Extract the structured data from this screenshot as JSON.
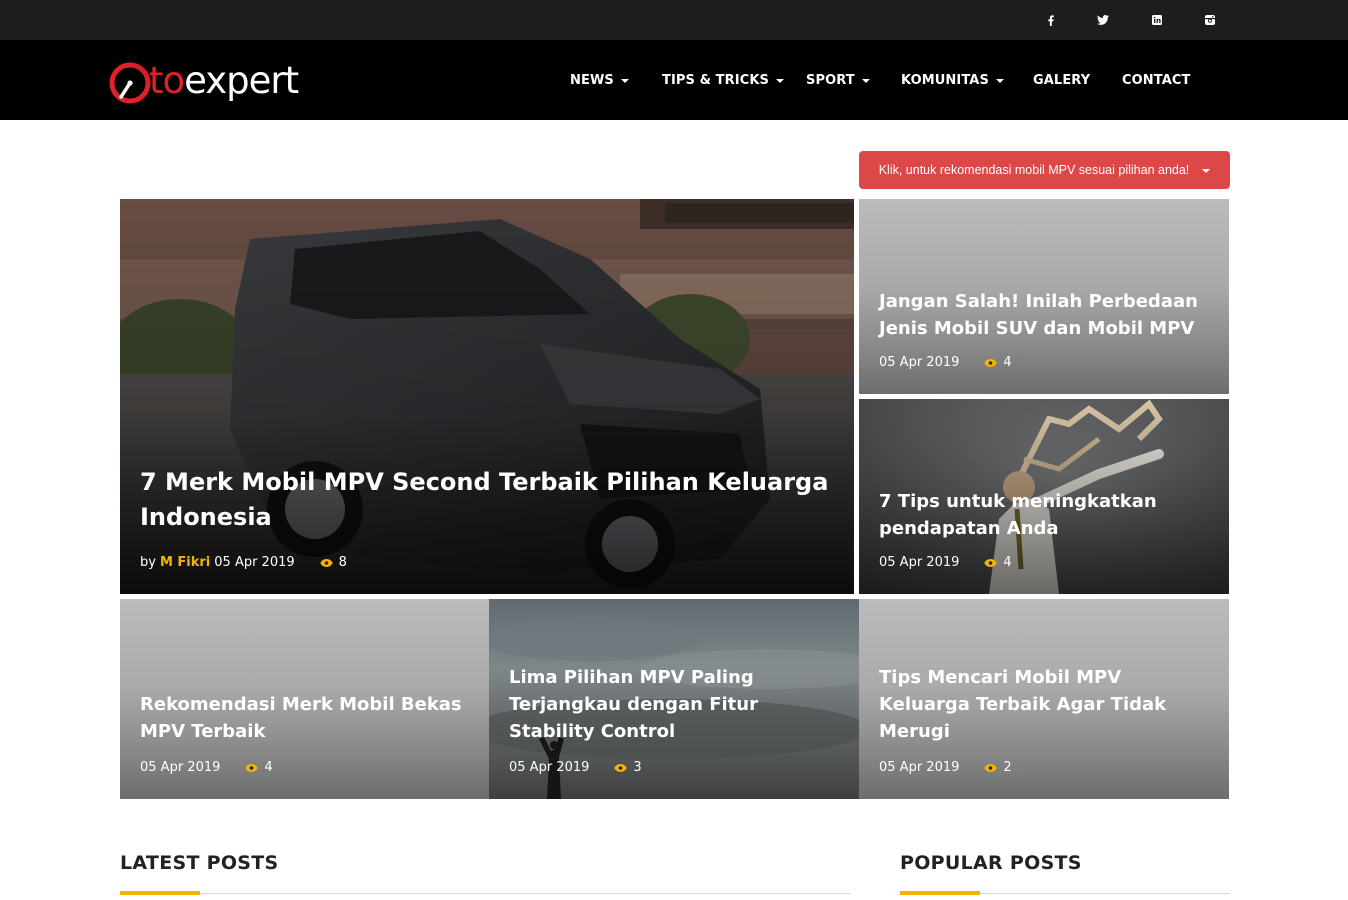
{
  "social": [
    {
      "name": "facebook-icon"
    },
    {
      "name": "twitter-icon"
    },
    {
      "name": "linkedin-icon"
    },
    {
      "name": "instagram-icon"
    }
  ],
  "logo": {
    "text_red": "to",
    "text_white": "expert"
  },
  "nav": [
    {
      "label": "NEWS",
      "dropdown": true
    },
    {
      "label": "TIPS & TRICKS",
      "dropdown": true
    },
    {
      "label": "SPORT",
      "dropdown": true
    },
    {
      "label": "KOMUNITAS",
      "dropdown": true
    },
    {
      "label": "GALERY",
      "dropdown": false
    },
    {
      "label": "CONTACT",
      "dropdown": false
    }
  ],
  "recommend": {
    "label": "Klik, untuk rekomendasi mobil MPV sesuai pilihan anda!"
  },
  "featured": {
    "title": "7 Merk Mobil MPV Second Terbaik Pilihan Keluarga Indonesia",
    "by": "by",
    "author": "M Fikri",
    "date": "05 Apr 2019",
    "views": "8"
  },
  "side_posts": [
    {
      "title": "Jangan Salah! Inilah Perbedaan Jenis Mobil SUV dan Mobil MPV",
      "date": "05 Apr 2019",
      "views": "4"
    },
    {
      "title": "7 Tips untuk meningkatkan pendapatan Anda",
      "date": "05 Apr 2019",
      "views": "4"
    }
  ],
  "bottom_posts": [
    {
      "title": "Rekomendasi Merk Mobil Bekas MPV Terbaik",
      "date": "05 Apr 2019",
      "views": "4"
    },
    {
      "title": "Lima Pilihan MPV Paling Terjangkau dengan Fitur Stability Control",
      "date": "05 Apr 2019",
      "views": "3"
    },
    {
      "title": "Tips Mencari Mobil MPV Keluarga Terbaik Agar Tidak Merugi",
      "date": "05 Apr 2019",
      "views": "2"
    }
  ],
  "sections": {
    "latest": "LATEST POSTS",
    "popular": "POPULAR POSTS"
  },
  "colors": {
    "accent": "#f5b400",
    "brand_red": "#e02127",
    "button_red": "#dc4848"
  }
}
